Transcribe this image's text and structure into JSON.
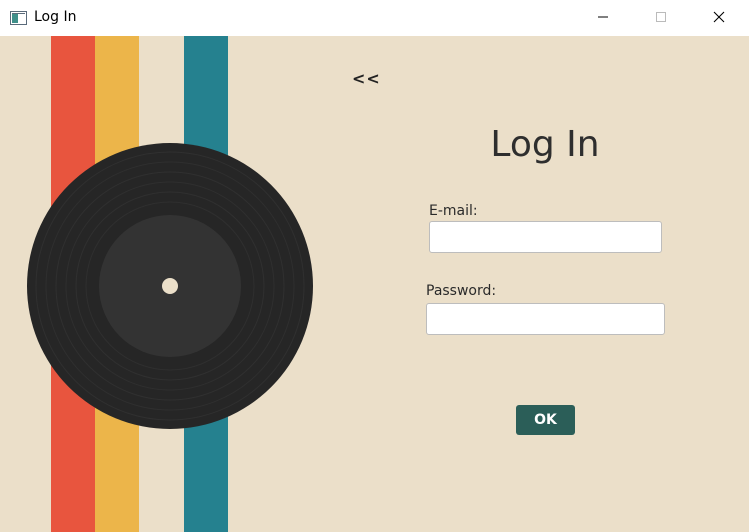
{
  "window": {
    "title": "Log In",
    "controls": [
      "minimize-icon",
      "maximize-icon",
      "close-icon"
    ]
  },
  "artwork": {
    "stripe_colors": [
      "#e8553e",
      "#ecb54a",
      "#25818f"
    ],
    "record_color": "#262626",
    "label_color": "#333333",
    "background": "#ebdfc9"
  },
  "nav": {
    "back_label": "<<"
  },
  "form": {
    "title": "Log In",
    "email_label": "E-mail:",
    "email_value": "",
    "password_label": "Password:",
    "password_value": "",
    "submit_label": "OK"
  },
  "colors": {
    "button": "#2b5e58",
    "background": "#ebdfc9"
  }
}
